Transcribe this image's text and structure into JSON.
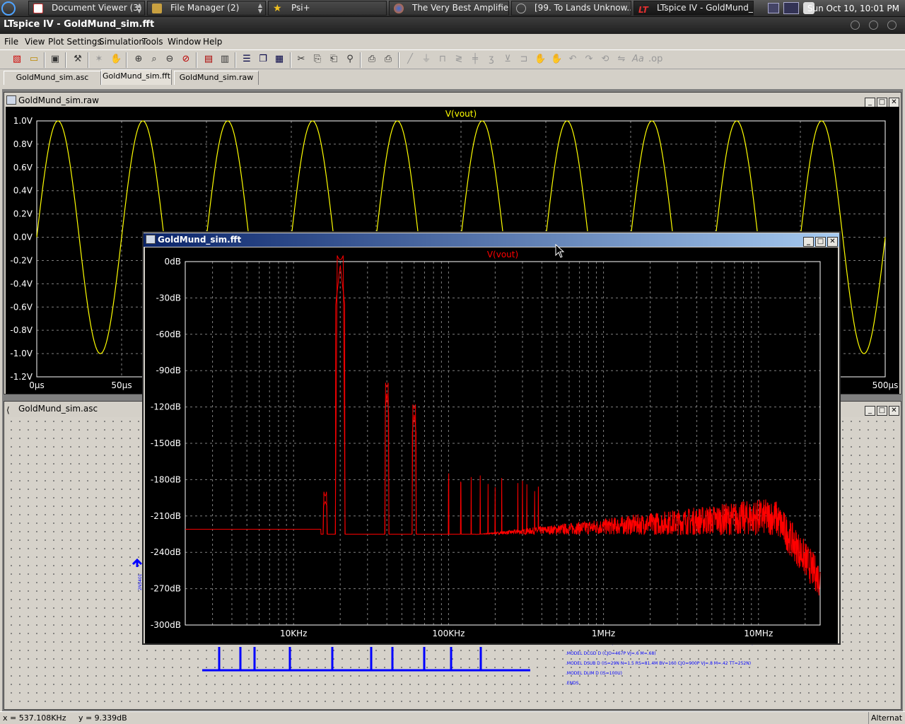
{
  "taskbar": {
    "tasks": [
      {
        "label": "Document Viewer (3)",
        "icon": "document-viewer-icon"
      },
      {
        "label": "File Manager (2)",
        "icon": "folder-icon"
      },
      {
        "label": "Psi+",
        "icon": "star-icon"
      },
      {
        "label": "The Very Best Amplifie...",
        "icon": "firefox-icon"
      },
      {
        "label": "[99. To Lands Unknow...",
        "icon": "music-player-icon"
      },
      {
        "label": "LTspice IV - GoldMund_...",
        "icon": "ltspice-icon"
      }
    ],
    "clock": "Sun Oct 10, 10:01 PM"
  },
  "app": {
    "title": "LTspice IV - GoldMund_sim.fft"
  },
  "menu": [
    "File",
    "View",
    "Plot Settings",
    "Simulation",
    "Tools",
    "Window",
    "Help"
  ],
  "tabs": [
    {
      "label": "GoldMund_sim.asc",
      "selected": false
    },
    {
      "label": "GoldMund_sim.fft",
      "selected": true
    },
    {
      "label": "GoldMund_sim.raw",
      "selected": false
    }
  ],
  "windows": {
    "raw": {
      "title": "GoldMund_sim.raw",
      "trace": "V(vout)"
    },
    "asc": {
      "title": "GoldMund_sim.asc"
    },
    "fft": {
      "title": "GoldMund_sim.fft",
      "trace": "V(vout)"
    }
  },
  "status": {
    "cursor": "x = 537.108KHz     y = 9.339dB",
    "right": "Alternat"
  },
  "colors": {
    "raw_trace": "#ffff00",
    "fft_trace": "#ff0000",
    "plot_bg": "#000000",
    "grid": "#808080",
    "schematic_wire": "#0000ff"
  },
  "chart_data": [
    {
      "type": "line",
      "title": "V(vout)",
      "xlabel": "",
      "ylabel": "",
      "x_ticks": [
        "0µs",
        "50µs",
        "500µs"
      ],
      "xlim": [
        0,
        500
      ],
      "x_unit": "µs",
      "y_ticks": [
        "1.0V",
        "0.8V",
        "0.6V",
        "0.4V",
        "0.2V",
        "0.0V",
        "-0.2V",
        "-0.4V",
        "-0.6V",
        "-0.8V",
        "-1.0V",
        "-1.2V"
      ],
      "ylim": [
        -1.2,
        1.0
      ],
      "grid": true,
      "series": [
        {
          "name": "V(vout)",
          "frequency_khz": 20,
          "amplitude": 1.0,
          "offset": 0.0,
          "phase": "sine"
        }
      ]
    },
    {
      "type": "line",
      "title": "V(vout)",
      "xscale": "log",
      "x_ticks": [
        "10KHz",
        "100KHz",
        "1MHz",
        "10MHz"
      ],
      "xlim": [
        2000,
        25000000
      ],
      "y_ticks": [
        "0dB",
        "-30dB",
        "-60dB",
        "-90dB",
        "-120dB",
        "-150dB",
        "-180dB",
        "-210dB",
        "-240dB",
        "-270dB",
        "-300dB"
      ],
      "ylim": [
        -300,
        0
      ],
      "grid": true,
      "series": [
        {
          "name": "V(vout)",
          "noise_floor_db": -225,
          "peaks": [
            {
              "freq_hz": 16000,
              "db": -198
            },
            {
              "freq_hz": 20000,
              "db": -3
            },
            {
              "freq_hz": 40000,
              "db": -108
            },
            {
              "freq_hz": 60000,
              "db": -126
            }
          ]
        }
      ]
    }
  ]
}
